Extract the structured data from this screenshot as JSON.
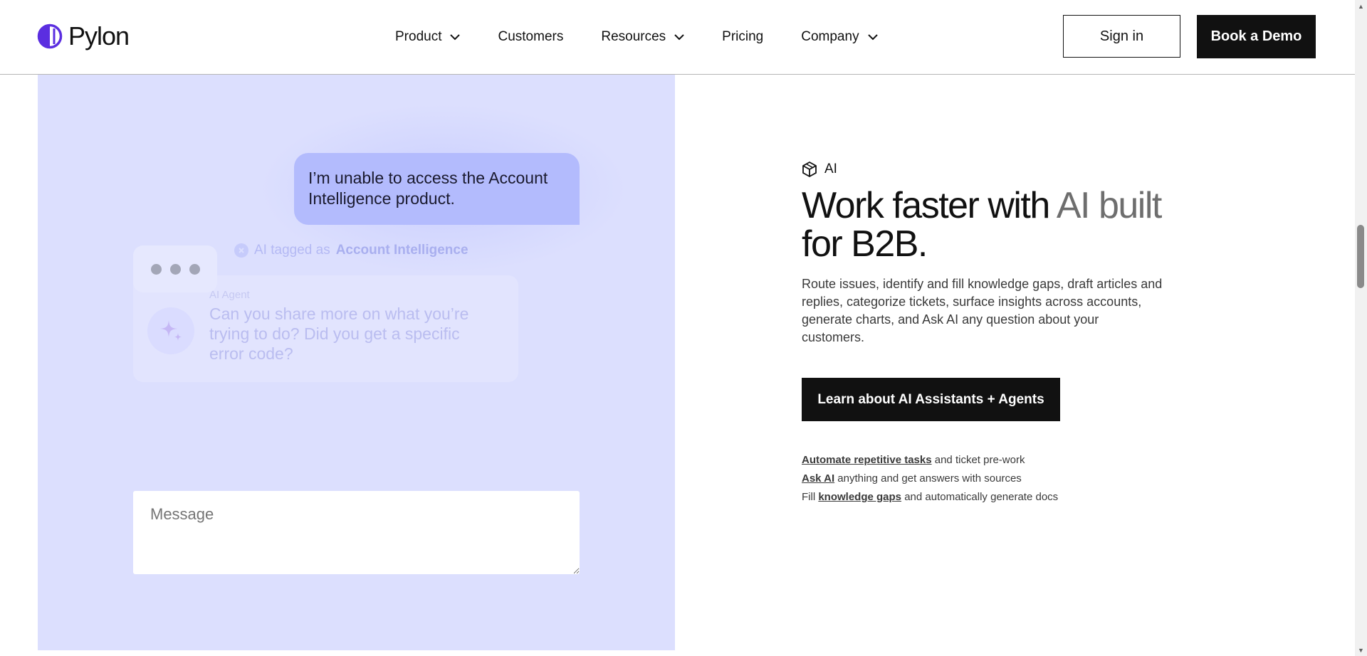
{
  "header": {
    "brand": "Pylon",
    "nav": [
      {
        "label": "Product",
        "has_dropdown": true
      },
      {
        "label": "Customers",
        "has_dropdown": false
      },
      {
        "label": "Resources",
        "has_dropdown": true
      },
      {
        "label": "Pricing",
        "has_dropdown": false
      },
      {
        "label": "Company",
        "has_dropdown": true
      }
    ],
    "sign_in": "Sign in",
    "book_demo": "Book a Demo"
  },
  "illustration": {
    "user_message": "I’m unable to access the Account Intelligence product.",
    "tag_prefix": "AI tagged as",
    "tag_value": "Account Intelligence",
    "agent_label": "AI Agent",
    "agent_message": "Can you share more on what you’re trying to do? Did you get a specific error code?",
    "input_placeholder": "Message"
  },
  "content": {
    "badge": "AI",
    "headline_part1": "Work faster with ",
    "headline_muted": "AI built",
    "headline_part2": " for B2B.",
    "body": "Route issues, identify and fill knowledge gaps, draft articles and replies, categorize tickets, surface insights across accounts, generate charts, and Ask AI any question about your customers.",
    "cta": "Learn about AI Assistants + Agents",
    "features": [
      {
        "prefix": "",
        "link": "Automate repetitive tasks",
        "suffix": " and ticket pre-work"
      },
      {
        "prefix": "",
        "link": "Ask AI",
        "suffix": " anything and get answers with sources"
      },
      {
        "prefix": "Fill ",
        "link": "knowledge gaps",
        "suffix": " and automatically generate docs"
      }
    ]
  },
  "colors": {
    "brand_purple": "#5b2ee0",
    "panel_bg": "#dcdffe",
    "user_bubble": "#b3bbfd",
    "button_dark": "#111111"
  }
}
